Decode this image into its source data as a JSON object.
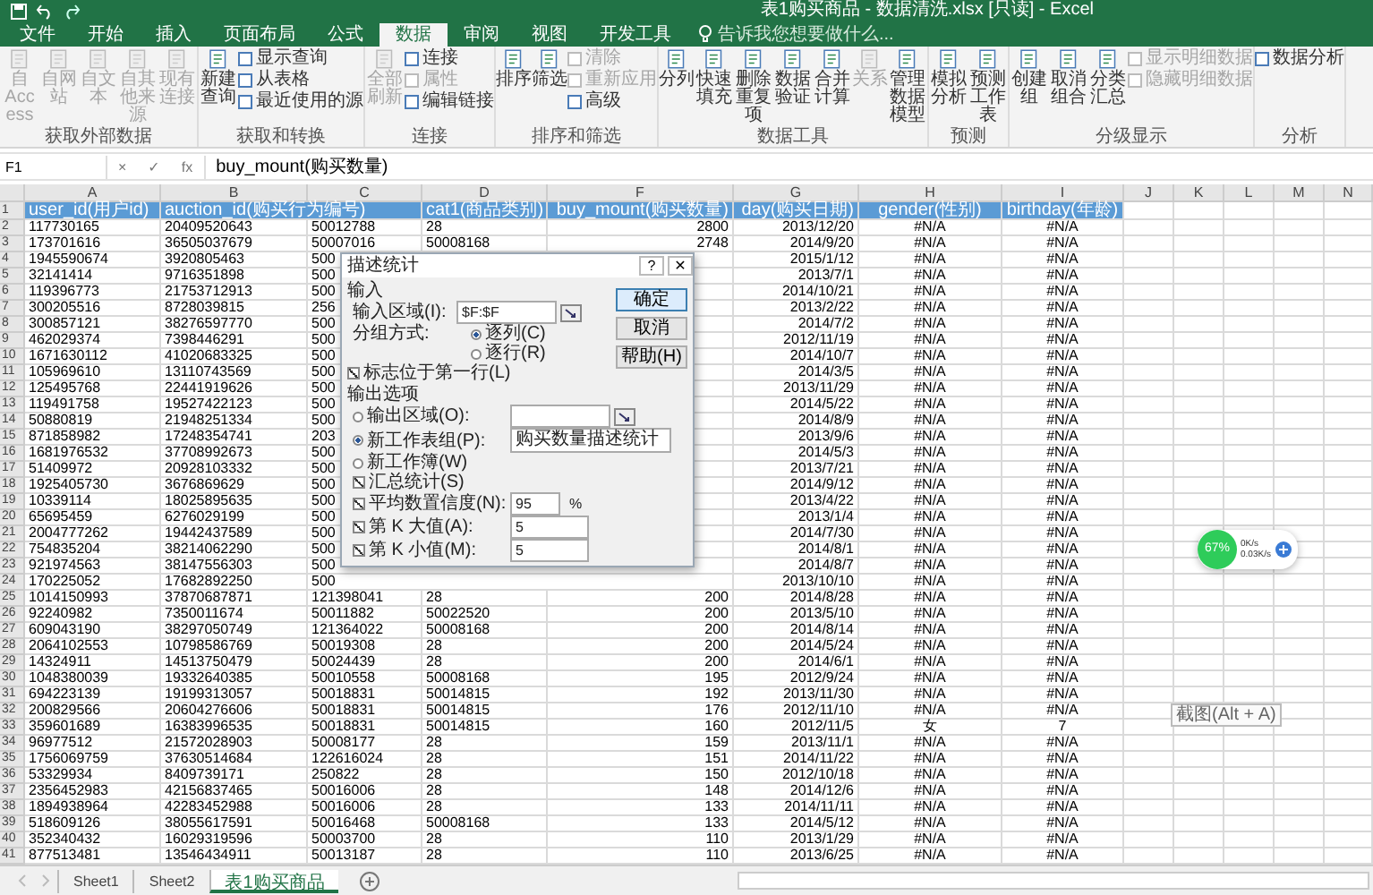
{
  "window": {
    "title": "表1购买商品 - 数据清洗.xlsx  [只读] - Excel"
  },
  "tabs": [
    {
      "label": "文件",
      "selected": false
    },
    {
      "label": "开始",
      "selected": false
    },
    {
      "label": "插入",
      "selected": false
    },
    {
      "label": "页面布局",
      "selected": false
    },
    {
      "label": "公式",
      "selected": false
    },
    {
      "label": "数据",
      "selected": true
    },
    {
      "label": "审阅",
      "selected": false
    },
    {
      "label": "视图",
      "selected": false
    },
    {
      "label": "开发工具",
      "selected": false
    }
  ],
  "search": {
    "placeholder": "告诉我您想要做什么..."
  },
  "ribbon": [
    {
      "label": "获取外部数据",
      "items": [
        {
          "label": "自 Access",
          "kind": "large",
          "disabled": true
        },
        {
          "label": "自网站",
          "kind": "large",
          "disabled": true
        },
        {
          "label": "自文本",
          "kind": "large",
          "disabled": true
        },
        {
          "label": "自其他来源",
          "kind": "large",
          "disabled": true
        },
        {
          "label": "现有连接",
          "kind": "large",
          "disabled": true
        }
      ]
    },
    {
      "label": "获取和转换",
      "items": [
        {
          "label": "新建查询",
          "kind": "large",
          "disabled": false
        },
        {
          "label": "显示查询",
          "kind": "small",
          "disabled": false
        },
        {
          "label": "从表格",
          "kind": "small",
          "disabled": false
        },
        {
          "label": "最近使用的源",
          "kind": "small",
          "disabled": false
        }
      ]
    },
    {
      "label": "连接",
      "items": [
        {
          "label": "全部刷新",
          "kind": "large",
          "disabled": true
        },
        {
          "label": "连接",
          "kind": "small",
          "disabled": false
        },
        {
          "label": "属性",
          "kind": "small",
          "disabled": true
        },
        {
          "label": "编辑链接",
          "kind": "small",
          "disabled": false
        }
      ]
    },
    {
      "label": "排序和筛选",
      "items": [
        {
          "label": "排序",
          "kind": "large",
          "disabled": false
        },
        {
          "label": "筛选",
          "kind": "large",
          "disabled": false
        },
        {
          "label": "清除",
          "kind": "small",
          "disabled": true
        },
        {
          "label": "重新应用",
          "kind": "small",
          "disabled": true
        },
        {
          "label": "高级",
          "kind": "small",
          "disabled": false
        }
      ]
    },
    {
      "label": "数据工具",
      "items": [
        {
          "label": "分列",
          "kind": "large",
          "disabled": false
        },
        {
          "label": "快速填充",
          "kind": "large",
          "disabled": false
        },
        {
          "label": "删除重复项",
          "kind": "large",
          "disabled": false
        },
        {
          "label": "数据验证",
          "kind": "large",
          "disabled": false
        },
        {
          "label": "合并计算",
          "kind": "large",
          "disabled": false
        },
        {
          "label": "关系",
          "kind": "large",
          "disabled": true
        },
        {
          "label": "管理数据模型",
          "kind": "large",
          "disabled": false
        }
      ]
    },
    {
      "label": "预测",
      "items": [
        {
          "label": "模拟分析",
          "kind": "large",
          "disabled": false
        },
        {
          "label": "预测工作表",
          "kind": "large",
          "disabled": false
        }
      ]
    },
    {
      "label": "分级显示",
      "items": [
        {
          "label": "创建组",
          "kind": "large",
          "disabled": false
        },
        {
          "label": "取消组合",
          "kind": "large",
          "disabled": false
        },
        {
          "label": "分类汇总",
          "kind": "large",
          "disabled": false
        },
        {
          "label": "显示明细数据",
          "kind": "small",
          "disabled": true
        },
        {
          "label": "隐藏明细数据",
          "kind": "small",
          "disabled": true
        }
      ]
    },
    {
      "label": "分析",
      "items": [
        {
          "label": "数据分析",
          "kind": "small",
          "disabled": false
        }
      ]
    }
  ],
  "formula_bar": {
    "name_box": "F1",
    "buttons": [
      "×",
      "✓",
      "fx"
    ],
    "formula": "buy_mount(购买数量)"
  },
  "columns": [
    "A",
    "B",
    "C",
    "D",
    "F",
    "G",
    "H",
    "I",
    "J",
    "K",
    "L",
    "M",
    "N"
  ],
  "rows": [
    {
      "number": "1",
      "kind": "header",
      "a": "user_id(用户id)",
      "b": "auction_id(购买行为编号)",
      "d": "cat1(商品类别)",
      "f": "buy_mount(购买数量)",
      "g": "day(购买日期)",
      "h": "gender(性别)",
      "i": "birthday(年龄)"
    },
    {
      "number": "2",
      "kind": "data",
      "a": "117730165",
      "b": "20409520643",
      "c": "50012788",
      "d": "28",
      "f": "2800",
      "g": "2013/12/20",
      "h": "#N/A",
      "i": "#N/A"
    },
    {
      "number": "3",
      "kind": "data",
      "a": "173701616",
      "b": "36505037679",
      "c": "50007016",
      "d": "50008168",
      "f": "2748",
      "g": "2014/9/20",
      "h": "#N/A",
      "i": "#N/A"
    },
    {
      "number": "4",
      "kind": "data",
      "a": "1945590674",
      "b": "3920805463",
      "c": "500",
      "g": "2015/1/12",
      "h": "#N/A",
      "i": "#N/A"
    },
    {
      "number": "5",
      "kind": "data",
      "a": "32141414",
      "b": "9716351898",
      "c": "500",
      "g": "2013/7/1",
      "h": "#N/A",
      "i": "#N/A"
    },
    {
      "number": "6",
      "kind": "data",
      "a": "119396773",
      "b": "21753712913",
      "c": "500",
      "g": "2014/10/21",
      "h": "#N/A",
      "i": "#N/A"
    },
    {
      "number": "7",
      "kind": "data",
      "a": "300205516",
      "b": "8728039815",
      "c": "256",
      "g": "2013/2/22",
      "h": "#N/A",
      "i": "#N/A"
    },
    {
      "number": "8",
      "kind": "data",
      "a": "300857121",
      "b": "38276597770",
      "c": "500",
      "g": "2014/7/2",
      "h": "#N/A",
      "i": "#N/A"
    },
    {
      "number": "9",
      "kind": "data",
      "a": "462029374",
      "b": "7398446291",
      "c": "500",
      "g": "2012/11/19",
      "h": "#N/A",
      "i": "#N/A"
    },
    {
      "number": "10",
      "kind": "data",
      "a": "1671630112",
      "b": "41020683325",
      "c": "500",
      "g": "2014/10/7",
      "h": "#N/A",
      "i": "#N/A"
    },
    {
      "number": "11",
      "kind": "data",
      "a": "105969610",
      "b": "13110743569",
      "c": "500",
      "g": "2014/3/5",
      "h": "#N/A",
      "i": "#N/A"
    },
    {
      "number": "12",
      "kind": "data",
      "a": "125495768",
      "b": "22441919626",
      "c": "500",
      "g": "2013/11/29",
      "h": "#N/A",
      "i": "#N/A"
    },
    {
      "number": "13",
      "kind": "data",
      "a": "119491758",
      "b": "19527422123",
      "c": "500",
      "g": "2014/5/22",
      "h": "#N/A",
      "i": "#N/A"
    },
    {
      "number": "14",
      "kind": "data",
      "a": "50880819",
      "b": "21948251334",
      "c": "500",
      "g": "2014/8/9",
      "h": "#N/A",
      "i": "#N/A"
    },
    {
      "number": "15",
      "kind": "data",
      "a": "871858982",
      "b": "17248354741",
      "c": "203",
      "g": "2013/9/6",
      "h": "#N/A",
      "i": "#N/A"
    },
    {
      "number": "16",
      "kind": "data",
      "a": "1681976532",
      "b": "37708992673",
      "c": "500",
      "g": "2014/5/3",
      "h": "#N/A",
      "i": "#N/A"
    },
    {
      "number": "17",
      "kind": "data",
      "a": "51409972",
      "b": "20928103332",
      "c": "500",
      "g": "2013/7/21",
      "h": "#N/A",
      "i": "#N/A"
    },
    {
      "number": "18",
      "kind": "data",
      "a": "1925405730",
      "b": "3676869629",
      "c": "500",
      "g": "2014/9/12",
      "h": "#N/A",
      "i": "#N/A"
    },
    {
      "number": "19",
      "kind": "data",
      "a": "10339114",
      "b": "18025895635",
      "c": "500",
      "g": "2013/4/22",
      "h": "#N/A",
      "i": "#N/A"
    },
    {
      "number": "20",
      "kind": "data",
      "a": "65695459",
      "b": "6276029199",
      "c": "500",
      "g": "2013/1/4",
      "h": "#N/A",
      "i": "#N/A"
    },
    {
      "number": "21",
      "kind": "data",
      "a": "2004777262",
      "b": "19442437589",
      "c": "500",
      "g": "2014/7/30",
      "h": "#N/A",
      "i": "#N/A"
    },
    {
      "number": "22",
      "kind": "data",
      "a": "754835204",
      "b": "38214062290",
      "c": "500",
      "g": "2014/8/1",
      "h": "#N/A",
      "i": "#N/A"
    },
    {
      "number": "23",
      "kind": "data",
      "a": "921974563",
      "b": "38147556303",
      "c": "500",
      "g": "2014/8/7",
      "h": "#N/A",
      "i": "#N/A"
    },
    {
      "number": "24",
      "kind": "data",
      "a": "170225052",
      "b": "17682892250",
      "c": "500",
      "g": "2013/10/10",
      "h": "#N/A",
      "i": "#N/A"
    },
    {
      "number": "25",
      "kind": "data",
      "a": "1014150993",
      "b": "37870687871",
      "c": "121398041",
      "d": "28",
      "f": "200",
      "g": "2014/8/28",
      "h": "#N/A",
      "i": "#N/A"
    },
    {
      "number": "26",
      "kind": "data",
      "a": "92240982",
      "b": "7350011674",
      "c": "50011882",
      "d": "50022520",
      "f": "200",
      "g": "2013/5/10",
      "h": "#N/A",
      "i": "#N/A"
    },
    {
      "number": "27",
      "kind": "data",
      "a": "609043190",
      "b": "38297050749",
      "c": "121364022",
      "d": "50008168",
      "f": "200",
      "g": "2014/8/14",
      "h": "#N/A",
      "i": "#N/A"
    },
    {
      "number": "28",
      "kind": "data",
      "a": "2064102553",
      "b": "10798586769",
      "c": "50019308",
      "d": "28",
      "f": "200",
      "g": "2014/5/24",
      "h": "#N/A",
      "i": "#N/A"
    },
    {
      "number": "29",
      "kind": "data",
      "a": "14324911",
      "b": "14513750479",
      "c": "50024439",
      "d": "28",
      "f": "200",
      "g": "2014/6/1",
      "h": "#N/A",
      "i": "#N/A"
    },
    {
      "number": "30",
      "kind": "data",
      "a": "1048380039",
      "b": "19332640385",
      "c": "50010558",
      "d": "50008168",
      "f": "195",
      "g": "2012/9/24",
      "h": "#N/A",
      "i": "#N/A"
    },
    {
      "number": "31",
      "kind": "data",
      "a": "694223139",
      "b": "19199313057",
      "c": "50018831",
      "d": "50014815",
      "f": "192",
      "g": "2013/11/30",
      "h": "#N/A",
      "i": "#N/A"
    },
    {
      "number": "32",
      "kind": "data",
      "a": "200829566",
      "b": "20604276606",
      "c": "50018831",
      "d": "50014815",
      "f": "176",
      "g": "2012/11/10",
      "h": "#N/A",
      "i": "#N/A"
    },
    {
      "number": "33",
      "kind": "data",
      "a": "359601689",
      "b": "16383996535",
      "c": "50018831",
      "d": "50014815",
      "f": "160",
      "g": "2012/11/5",
      "h": "女",
      "i": "7"
    },
    {
      "number": "34",
      "kind": "data",
      "a": "96977512",
      "b": "21572028903",
      "c": "50008177",
      "d": "28",
      "f": "159",
      "g": "2013/11/1",
      "h": "#N/A",
      "i": "#N/A"
    },
    {
      "number": "35",
      "kind": "data",
      "a": "1756069759",
      "b": "37630514684",
      "c": "122616024",
      "d": "28",
      "f": "151",
      "g": "2014/11/22",
      "h": "#N/A",
      "i": "#N/A"
    },
    {
      "number": "36",
      "kind": "data",
      "a": "53329934",
      "b": "8409739171",
      "c": "250822",
      "d": "28",
      "f": "150",
      "g": "2012/10/18",
      "h": "#N/A",
      "i": "#N/A"
    },
    {
      "number": "37",
      "kind": "data",
      "a": "2356452983",
      "b": "42156837465",
      "c": "50016006",
      "d": "28",
      "f": "148",
      "g": "2014/12/6",
      "h": "#N/A",
      "i": "#N/A"
    },
    {
      "number": "38",
      "kind": "data",
      "a": "1894938964",
      "b": "42283452988",
      "c": "50016006",
      "d": "28",
      "f": "133",
      "g": "2014/11/11",
      "h": "#N/A",
      "i": "#N/A"
    },
    {
      "number": "39",
      "kind": "data",
      "a": "518609126",
      "b": "38055617591",
      "c": "50016468",
      "d": "50008168",
      "f": "133",
      "g": "2014/5/12",
      "h": "#N/A",
      "i": "#N/A"
    },
    {
      "number": "40",
      "kind": "data",
      "a": "352340432",
      "b": "16029319596",
      "c": "50003700",
      "d": "28",
      "f": "110",
      "g": "2013/1/29",
      "h": "#N/A",
      "i": "#N/A"
    },
    {
      "number": "41",
      "kind": "data",
      "a": "877513481",
      "b": "13546434911",
      "c": "50013187",
      "d": "28",
      "f": "110",
      "g": "2013/6/25",
      "h": "#N/A",
      "i": "#N/A"
    }
  ],
  "dialog": {
    "title": "描述统计",
    "help": "?",
    "close": "✕",
    "input_section": "输入",
    "input_range": {
      "label": "输入区域(I):",
      "value": "$F:$F"
    },
    "grouping": {
      "label": "分组方式:",
      "options": [
        {
          "label": "逐列(C)",
          "selected": true
        },
        {
          "label": "逐行(R)",
          "selected": false
        }
      ]
    },
    "first_row": {
      "label": "标志位于第一行(L)",
      "checked": true
    },
    "buttons": [
      "确定",
      "取消",
      "帮助(H)"
    ],
    "output_section": "输出选项",
    "output_options": [
      {
        "label": "输出区域(O):",
        "selected": false,
        "kind": "range"
      },
      {
        "label": "新工作表组(P):",
        "selected": true,
        "kind": "text",
        "value": "购买数量描述统计"
      },
      {
        "label": "新工作簿(W)",
        "selected": false,
        "kind": "none"
      }
    ],
    "statistics": [
      {
        "label": "汇总统计(S)",
        "checked": true
      },
      {
        "label": "平均数置信度(N):",
        "checked": true,
        "value": "95",
        "unit": "%"
      },
      {
        "label": "第 K 大值(A):",
        "checked": true,
        "value": "5"
      },
      {
        "label": "第 K 小值(M):",
        "checked": true,
        "value": "5"
      }
    ]
  },
  "network_monitor": {
    "percent": "67%",
    "upload": "0K/s",
    "download": "0.03K/s"
  },
  "tooltip": "截图(Alt + A)",
  "sheet_tabs": [
    {
      "label": "Sheet1",
      "selected": false
    },
    {
      "label": "Sheet2",
      "selected": false
    },
    {
      "label": "表1购买商品",
      "selected": true
    }
  ]
}
